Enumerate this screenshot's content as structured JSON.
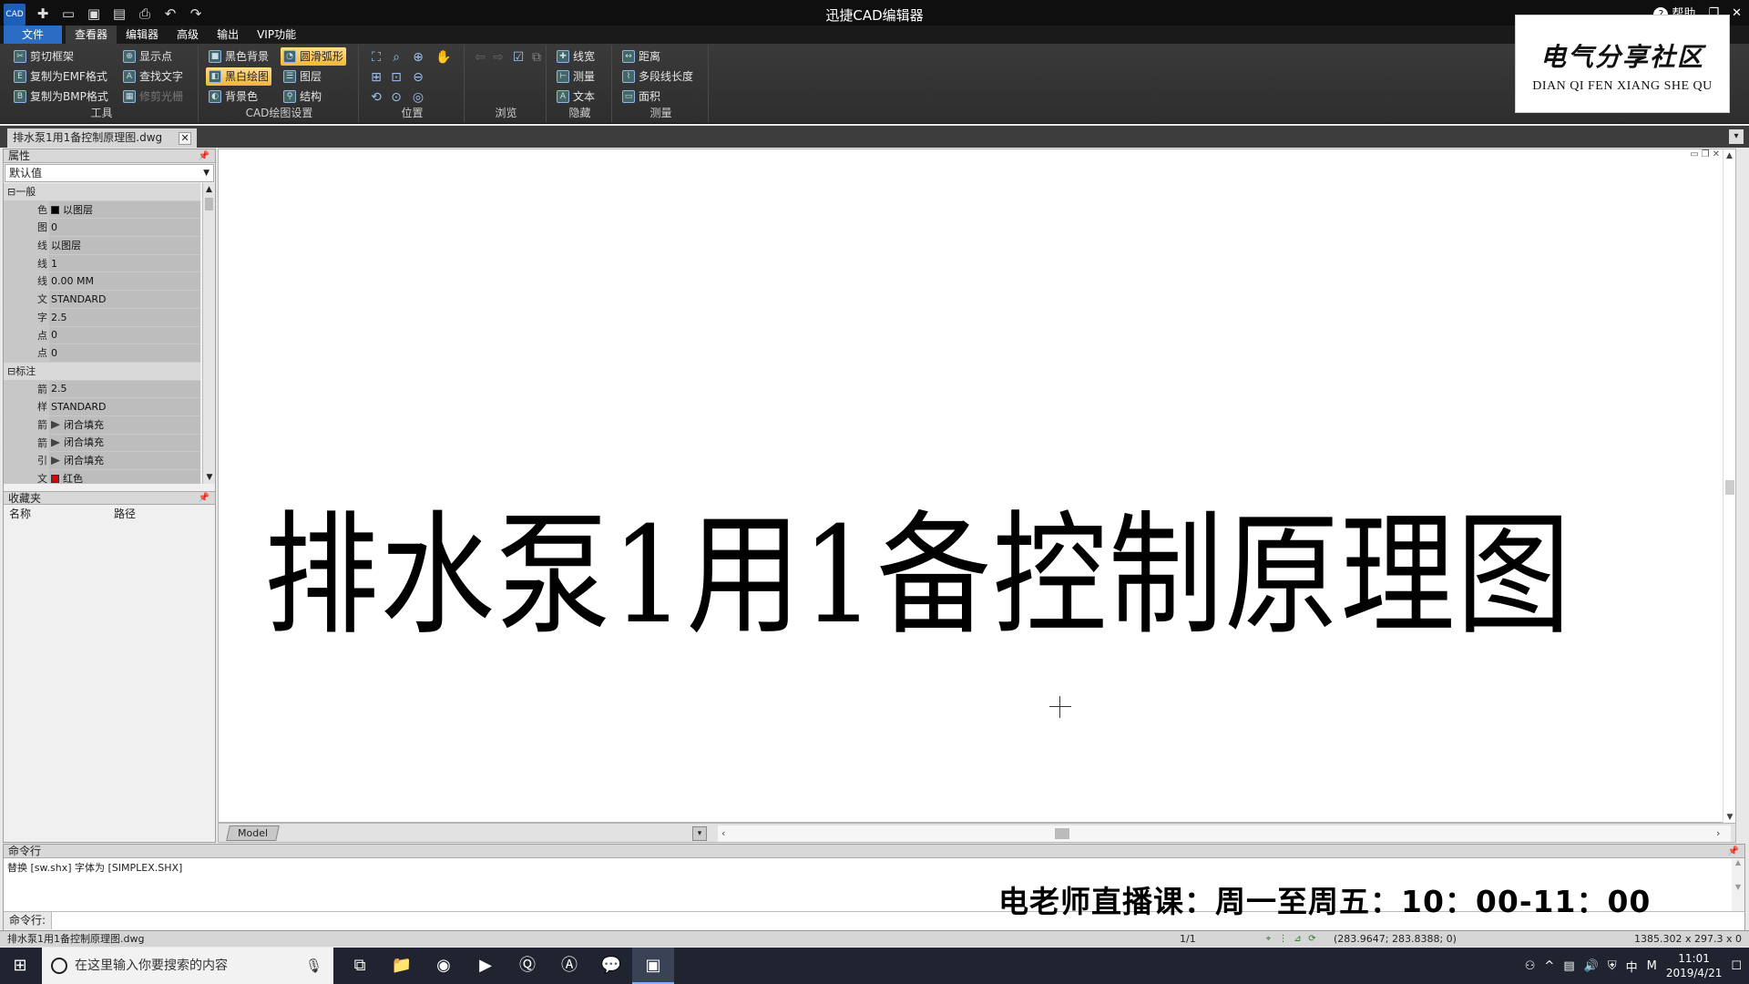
{
  "window": {
    "title": "迅捷CAD编辑器",
    "logo": "CAD",
    "help_label": "帮助"
  },
  "qat": [
    "new-icon",
    "open-icon",
    "save-icon",
    "save-as-icon",
    "print-icon",
    "undo-icon",
    "redo-icon"
  ],
  "menu": {
    "file": "文件",
    "tabs": [
      "查看器",
      "编辑器",
      "高级",
      "输出",
      "VIP功能"
    ],
    "active": "查看器"
  },
  "ribbon": {
    "tools": {
      "label": "工具",
      "cut_frame": "剪切框架",
      "copy_emf": "复制为EMF格式",
      "copy_bmp": "复制为BMP格式",
      "show_points": "显示点",
      "find_text": "查找文字",
      "trim_raster": "修剪光栅"
    },
    "cad_settings": {
      "label": "CAD绘图设置",
      "black_bg": "黑色背景",
      "smooth_arc": "圆滑弧形",
      "bw_draw": "黑白绘图",
      "layers": "图层",
      "bg_color": "背景色",
      "structure": "结构"
    },
    "position": {
      "label": "位置"
    },
    "browse": {
      "label": "浏览"
    },
    "hide": {
      "label": "隐藏",
      "line_width": "线宽",
      "measure": "测量",
      "text": "文本"
    },
    "measure": {
      "label": "测量",
      "distance": "距离",
      "polyline_length": "多段线长度",
      "area": "面积"
    }
  },
  "brand": {
    "cn": "电气分享社区",
    "en": "DIAN QI FEN XIANG SHE QU"
  },
  "doc_tab": {
    "name": "排水泵1用1备控制原理图.dwg"
  },
  "properties": {
    "header": "属性",
    "selector": "默认值",
    "rows": [
      {
        "key": "一般",
        "value": "",
        "category": true
      },
      {
        "key": "色",
        "value": "以图层",
        "swatch": "#000000"
      },
      {
        "key": "图",
        "value": "0"
      },
      {
        "key": "线",
        "value": "以图层"
      },
      {
        "key": "线",
        "value": "1"
      },
      {
        "key": "线",
        "value": "0.00 MM"
      },
      {
        "key": "文",
        "value": "STANDARD"
      },
      {
        "key": "字",
        "value": "2.5"
      },
      {
        "key": "点",
        "value": "0"
      },
      {
        "key": "点",
        "value": "0"
      },
      {
        "key": "标注",
        "value": "",
        "category": true
      },
      {
        "key": "箭",
        "value": "2.5"
      },
      {
        "key": "样",
        "value": "STANDARD"
      },
      {
        "key": "箭",
        "value": "闭合填充",
        "fill": true
      },
      {
        "key": "箭",
        "value": "闭合填充",
        "fill": true
      },
      {
        "key": "引",
        "value": "闭合填充",
        "fill": true
      },
      {
        "key": "文",
        "value": "红色",
        "swatch": "#e00000"
      }
    ]
  },
  "favorites": {
    "header": "收藏夹",
    "col_name": "名称",
    "col_path": "路径"
  },
  "canvas": {
    "drawing_title": "排水泵1用1备控制原理图",
    "model_tab": "Model"
  },
  "command": {
    "header": "命令行",
    "output": "替换 [sw.shx] 字体为 [SIMPLEX.SHX]",
    "prompt": "命令行:",
    "promo": "电老师直播课：周一至周五：10：00-11：00"
  },
  "status": {
    "file": "排水泵1用1备控制原理图.dwg",
    "page": "1/1",
    "coords": "(283.9647; 283.8388; 0)",
    "size": "1385.302 x 297.3 x 0"
  },
  "taskbar": {
    "search_placeholder": "在这里输入你要搜索的内容",
    "ime": "中",
    "time": "11:01",
    "date": "2019/4/21"
  },
  "colors": {
    "accent": "#2b6cc4",
    "highlight": "#f4b832",
    "ribbon_bg": "#333333"
  }
}
